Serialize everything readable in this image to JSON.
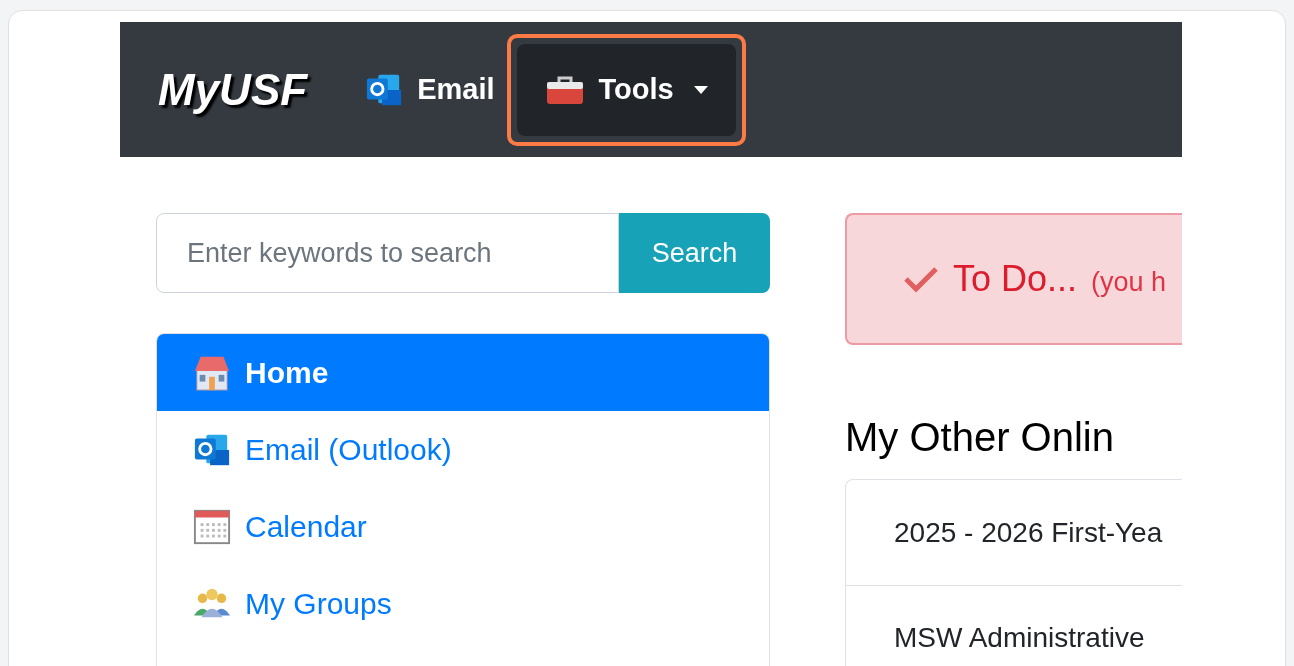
{
  "navbar": {
    "brand": "MyUSF",
    "links": [
      {
        "label": "Email",
        "kind": "outlook",
        "highlighted": false,
        "dropdown": false
      },
      {
        "label": "Tools",
        "kind": "toolbox",
        "highlighted": true,
        "dropdown": true
      }
    ]
  },
  "search": {
    "placeholder": "Enter keywords to search",
    "button": "Search"
  },
  "sidebar": {
    "items": [
      {
        "label": "Home",
        "kind": "house",
        "selected": true
      },
      {
        "label": "Email (Outlook)",
        "kind": "outlook",
        "selected": false
      },
      {
        "label": "Calendar",
        "kind": "calendar",
        "selected": false
      },
      {
        "label": "My Groups",
        "kind": "group",
        "selected": false
      }
    ]
  },
  "alert": {
    "title": "To Do...",
    "note": "(you h"
  },
  "section": {
    "heading": "My Other Onlin",
    "items": [
      "2025 - 2026 First-Yea",
      "MSW Administrative"
    ]
  }
}
